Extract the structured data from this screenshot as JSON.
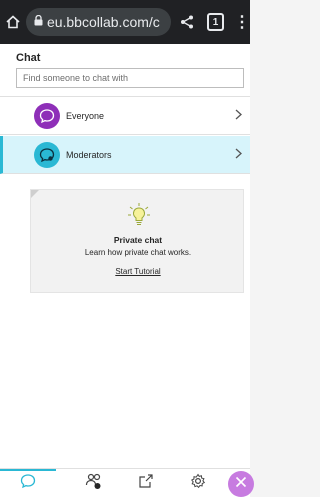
{
  "browser": {
    "url": "eu.bbcollab.com/c",
    "tab_count": "1"
  },
  "panel": {
    "title": "Chat",
    "search_placeholder": "Find someone to chat with"
  },
  "chat_rows": [
    {
      "label": "Everyone",
      "avatar_color": "#8e2fb8"
    },
    {
      "label": "Moderators",
      "avatar_color": "#2ab8d4"
    }
  ],
  "tutorial": {
    "title": "Private chat",
    "description": "Learn how private chat works.",
    "link": "Start Tutorial"
  },
  "colors": {
    "accent": "#2ab8d4",
    "selected_row_bg": "#d7f4fb",
    "close_button": "#c77be0"
  },
  "icons": [
    "home-icon",
    "lock-icon",
    "share-icon",
    "tabs-icon",
    "more-icon",
    "chat-bubble-icon",
    "moderator-icon",
    "chevron-right-icon",
    "lightbulb-icon",
    "attendees-icon",
    "share-content-icon",
    "settings-icon",
    "close-icon"
  ]
}
